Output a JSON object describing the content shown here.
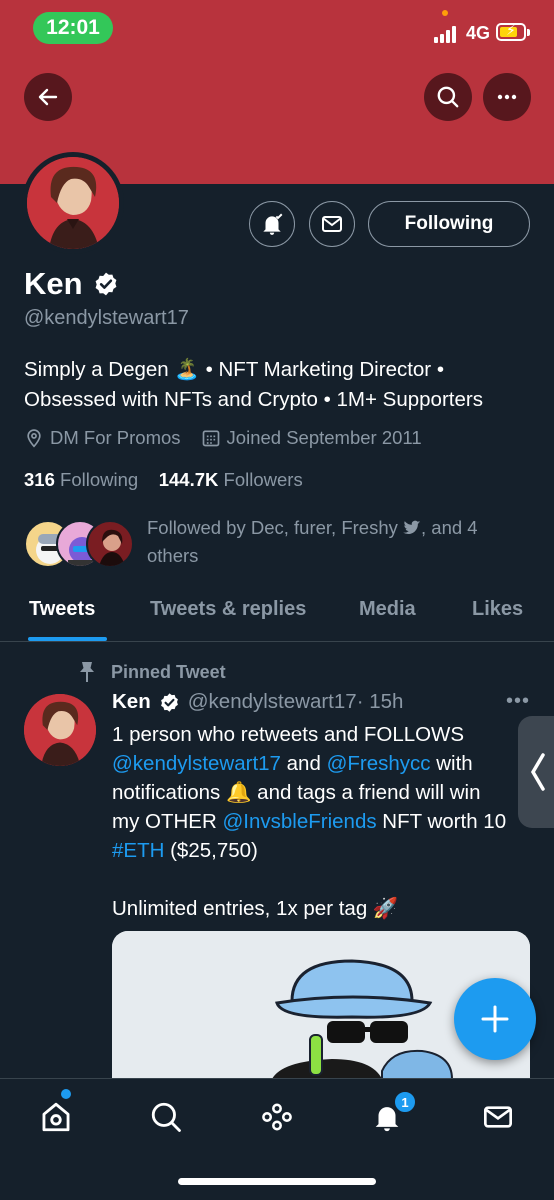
{
  "status_bar": {
    "time": "12:01",
    "network": "4G"
  },
  "profile": {
    "name": "Ken",
    "handle": "@kendylstewart17",
    "bio_line1": "Simply a Degen 🏝️ • NFT Marketing Director •",
    "bio_line2": "Obsessed with NFTs and Crypto • 1M+ Supporters",
    "location": "DM For Promos",
    "joined": "Joined September 2011",
    "following_count": "316",
    "following_label": "Following",
    "followers_count": "144.7K",
    "followers_label": "Followers",
    "followed_by_line1": "Followed by Dec, furer, Freshy",
    "followed_by_line1b": ", and 4",
    "followed_by_line2": "others",
    "follow_button": "Following"
  },
  "tabs": [
    "Tweets",
    "Tweets & replies",
    "Media",
    "Likes"
  ],
  "tweet": {
    "pinned_label": "Pinned Tweet",
    "author_name": "Ken",
    "author_handle": "@kendylstewart17",
    "time": "· 15h",
    "line1": "1 person who retweets and FOLLOWS",
    "mention1": "@kendylstewart17",
    "and_text": " and ",
    "mention2": "@Freshycc",
    "with_text": " with",
    "line3": "notifications 🔔 and tags a friend will win",
    "line4a": "my OTHER ",
    "mention3": "@InvsbleFriends",
    "line4b": " NFT worth 10",
    "hashtag": "#ETH",
    "line5b": " ($25,750)",
    "line6": "Unlimited entries, 1x per tag 🚀"
  },
  "bottom_nav": {
    "notifications_badge": "1"
  },
  "colors": {
    "banner": "#b8333d",
    "accent": "#1d9bf0",
    "background": "#15202b",
    "muted": "#8b98a5"
  }
}
